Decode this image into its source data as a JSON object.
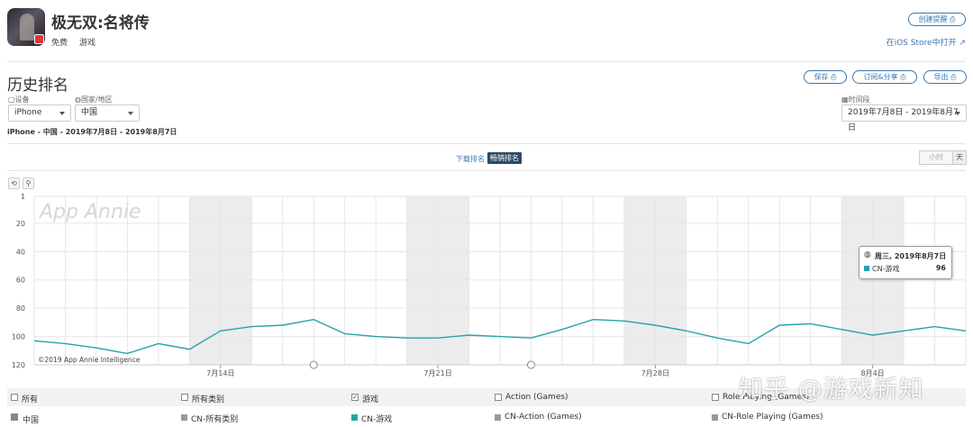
{
  "app": {
    "title": "极无双:名将传",
    "price": "免费",
    "category": "游戏",
    "icon": "app-game-icon"
  },
  "header": {
    "create_alert": "创建提醒 ⎙",
    "ios_store_link": "在iOS Store中打开 ↗"
  },
  "page": {
    "title": "历史排名",
    "save": "保存 ⎙",
    "subscribe": "订阅&分享 ⎙",
    "export": "导出 ⎙"
  },
  "filters": {
    "device_label": "▢设备",
    "device_value": "iPhone",
    "country_label": "◍国家/地区",
    "country_value": "中国",
    "range_label": "▦时间段",
    "range_value": "2019年7月8日 - 2019年8月7日"
  },
  "subtitle": "iPhone - 中国 - 2019年7月8日 - 2019年8月7日",
  "tabs": {
    "downloads": "下载排名",
    "grossing": "畅销排名"
  },
  "granularity": {
    "hour": "小时",
    "day": "天"
  },
  "tools": {
    "reset": "⟲",
    "zoom": "⚲"
  },
  "chart_data": {
    "type": "line",
    "watermark": "App Annie",
    "copyright": "©2019 App Annie Intelligence",
    "y_ticks": [
      "1",
      "20",
      "40",
      "60",
      "80",
      "100",
      "120"
    ],
    "ylim": [
      1,
      120
    ],
    "y_reversed": true,
    "x_tick_labels": [
      "7月14日",
      "7月21日",
      "7月28日",
      "8月4日"
    ],
    "x_tick_index": [
      6,
      13,
      20,
      27
    ],
    "weekend_bands": [
      [
        5,
        7
      ],
      [
        12,
        14
      ],
      [
        19,
        21
      ],
      [
        26,
        28
      ]
    ],
    "grid": true,
    "series": [
      {
        "name": "CN-游戏",
        "color": "#26a3ab",
        "x": [
          "2019-07-08",
          "2019-07-09",
          "2019-07-10",
          "2019-07-11",
          "2019-07-12",
          "2019-07-13",
          "2019-07-14",
          "2019-07-15",
          "2019-07-16",
          "2019-07-17",
          "2019-07-18",
          "2019-07-19",
          "2019-07-20",
          "2019-07-21",
          "2019-07-22",
          "2019-07-23",
          "2019-07-24",
          "2019-07-25",
          "2019-07-26",
          "2019-07-27",
          "2019-07-28",
          "2019-07-29",
          "2019-07-30",
          "2019-07-31",
          "2019-08-01",
          "2019-08-02",
          "2019-08-03",
          "2019-08-04",
          "2019-08-05",
          "2019-08-06",
          "2019-08-07"
        ],
        "values": [
          103,
          105,
          108,
          112,
          105,
          109,
          96,
          93,
          92,
          88,
          98,
          100,
          101,
          101,
          99,
          100,
          101,
          95,
          88,
          89,
          92,
          96,
          101,
          105,
          92,
          91,
          95,
          99,
          96,
          93,
          96
        ]
      }
    ],
    "annotations_on": [
      "2019-07-17",
      "2019-07-24"
    ],
    "tooltip": {
      "date": "周三, 2019年8月7日",
      "series": "CN-游戏",
      "value": "96"
    }
  },
  "legend": {
    "row1": [
      {
        "label": "所有",
        "checked": false
      },
      {
        "label": "所有类别",
        "checked": false
      },
      {
        "label": "游戏",
        "checked": true
      },
      {
        "label": "Action (Games)",
        "checked": false
      },
      {
        "label": "Role Playing (Games)",
        "checked": false
      }
    ],
    "country": "中国",
    "row2": [
      {
        "label": "CN-所有类别",
        "color": "#999999"
      },
      {
        "label": "CN-游戏",
        "color": "#26a3ab"
      },
      {
        "label": "CN-Action (Games)",
        "color": "#999999"
      },
      {
        "label": "CN-Role Playing (Games)",
        "color": "#999999"
      }
    ]
  },
  "watermark": "知乎 @游戏新知"
}
